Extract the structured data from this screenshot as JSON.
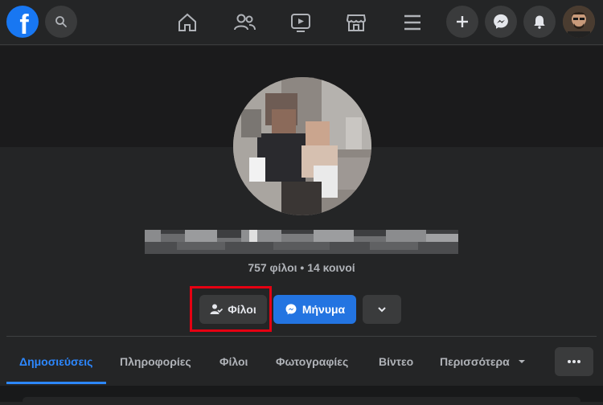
{
  "topbar": {
    "logo_letter": "f",
    "nav_icons": [
      "home-icon",
      "friends-icon",
      "watch-icon",
      "marketplace-icon",
      "menu-icon"
    ],
    "right_icons": [
      "plus-icon",
      "messenger-icon",
      "notifications-icon"
    ]
  },
  "profile": {
    "friends_summary": "757 φίλοι • 14 κοινοί"
  },
  "actions": {
    "friends_label": "Φίλοι",
    "message_label": "Μήνυμα"
  },
  "tabs": [
    {
      "label": "Δημοσιεύσεις",
      "active": true
    },
    {
      "label": "Πληροφορίες",
      "active": false
    },
    {
      "label": "Φίλοι",
      "active": false
    },
    {
      "label": "Φωτογραφίες",
      "active": false
    },
    {
      "label": "Βίντεο",
      "active": false
    },
    {
      "label": "Περισσότερα",
      "active": false
    }
  ],
  "colors": {
    "accent": "#2374e1",
    "highlight": "#e50012",
    "background": "#242526"
  }
}
